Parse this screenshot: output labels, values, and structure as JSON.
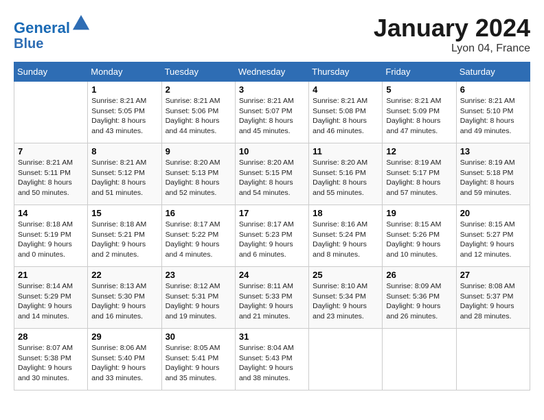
{
  "header": {
    "logo_line1": "General",
    "logo_line2": "Blue",
    "month_title": "January 2024",
    "location": "Lyon 04, France"
  },
  "weekdays": [
    "Sunday",
    "Monday",
    "Tuesday",
    "Wednesday",
    "Thursday",
    "Friday",
    "Saturday"
  ],
  "weeks": [
    [
      {
        "day": "",
        "sunrise": "",
        "sunset": "",
        "daylight": ""
      },
      {
        "day": "1",
        "sunrise": "Sunrise: 8:21 AM",
        "sunset": "Sunset: 5:05 PM",
        "daylight": "Daylight: 8 hours and 43 minutes."
      },
      {
        "day": "2",
        "sunrise": "Sunrise: 8:21 AM",
        "sunset": "Sunset: 5:06 PM",
        "daylight": "Daylight: 8 hours and 44 minutes."
      },
      {
        "day": "3",
        "sunrise": "Sunrise: 8:21 AM",
        "sunset": "Sunset: 5:07 PM",
        "daylight": "Daylight: 8 hours and 45 minutes."
      },
      {
        "day": "4",
        "sunrise": "Sunrise: 8:21 AM",
        "sunset": "Sunset: 5:08 PM",
        "daylight": "Daylight: 8 hours and 46 minutes."
      },
      {
        "day": "5",
        "sunrise": "Sunrise: 8:21 AM",
        "sunset": "Sunset: 5:09 PM",
        "daylight": "Daylight: 8 hours and 47 minutes."
      },
      {
        "day": "6",
        "sunrise": "Sunrise: 8:21 AM",
        "sunset": "Sunset: 5:10 PM",
        "daylight": "Daylight: 8 hours and 49 minutes."
      }
    ],
    [
      {
        "day": "7",
        "sunrise": "Sunrise: 8:21 AM",
        "sunset": "Sunset: 5:11 PM",
        "daylight": "Daylight: 8 hours and 50 minutes."
      },
      {
        "day": "8",
        "sunrise": "Sunrise: 8:21 AM",
        "sunset": "Sunset: 5:12 PM",
        "daylight": "Daylight: 8 hours and 51 minutes."
      },
      {
        "day": "9",
        "sunrise": "Sunrise: 8:20 AM",
        "sunset": "Sunset: 5:13 PM",
        "daylight": "Daylight: 8 hours and 52 minutes."
      },
      {
        "day": "10",
        "sunrise": "Sunrise: 8:20 AM",
        "sunset": "Sunset: 5:15 PM",
        "daylight": "Daylight: 8 hours and 54 minutes."
      },
      {
        "day": "11",
        "sunrise": "Sunrise: 8:20 AM",
        "sunset": "Sunset: 5:16 PM",
        "daylight": "Daylight: 8 hours and 55 minutes."
      },
      {
        "day": "12",
        "sunrise": "Sunrise: 8:19 AM",
        "sunset": "Sunset: 5:17 PM",
        "daylight": "Daylight: 8 hours and 57 minutes."
      },
      {
        "day": "13",
        "sunrise": "Sunrise: 8:19 AM",
        "sunset": "Sunset: 5:18 PM",
        "daylight": "Daylight: 8 hours and 59 minutes."
      }
    ],
    [
      {
        "day": "14",
        "sunrise": "Sunrise: 8:18 AM",
        "sunset": "Sunset: 5:19 PM",
        "daylight": "Daylight: 9 hours and 0 minutes."
      },
      {
        "day": "15",
        "sunrise": "Sunrise: 8:18 AM",
        "sunset": "Sunset: 5:21 PM",
        "daylight": "Daylight: 9 hours and 2 minutes."
      },
      {
        "day": "16",
        "sunrise": "Sunrise: 8:17 AM",
        "sunset": "Sunset: 5:22 PM",
        "daylight": "Daylight: 9 hours and 4 minutes."
      },
      {
        "day": "17",
        "sunrise": "Sunrise: 8:17 AM",
        "sunset": "Sunset: 5:23 PM",
        "daylight": "Daylight: 9 hours and 6 minutes."
      },
      {
        "day": "18",
        "sunrise": "Sunrise: 8:16 AM",
        "sunset": "Sunset: 5:24 PM",
        "daylight": "Daylight: 9 hours and 8 minutes."
      },
      {
        "day": "19",
        "sunrise": "Sunrise: 8:15 AM",
        "sunset": "Sunset: 5:26 PM",
        "daylight": "Daylight: 9 hours and 10 minutes."
      },
      {
        "day": "20",
        "sunrise": "Sunrise: 8:15 AM",
        "sunset": "Sunset: 5:27 PM",
        "daylight": "Daylight: 9 hours and 12 minutes."
      }
    ],
    [
      {
        "day": "21",
        "sunrise": "Sunrise: 8:14 AM",
        "sunset": "Sunset: 5:29 PM",
        "daylight": "Daylight: 9 hours and 14 minutes."
      },
      {
        "day": "22",
        "sunrise": "Sunrise: 8:13 AM",
        "sunset": "Sunset: 5:30 PM",
        "daylight": "Daylight: 9 hours and 16 minutes."
      },
      {
        "day": "23",
        "sunrise": "Sunrise: 8:12 AM",
        "sunset": "Sunset: 5:31 PM",
        "daylight": "Daylight: 9 hours and 19 minutes."
      },
      {
        "day": "24",
        "sunrise": "Sunrise: 8:11 AM",
        "sunset": "Sunset: 5:33 PM",
        "daylight": "Daylight: 9 hours and 21 minutes."
      },
      {
        "day": "25",
        "sunrise": "Sunrise: 8:10 AM",
        "sunset": "Sunset: 5:34 PM",
        "daylight": "Daylight: 9 hours and 23 minutes."
      },
      {
        "day": "26",
        "sunrise": "Sunrise: 8:09 AM",
        "sunset": "Sunset: 5:36 PM",
        "daylight": "Daylight: 9 hours and 26 minutes."
      },
      {
        "day": "27",
        "sunrise": "Sunrise: 8:08 AM",
        "sunset": "Sunset: 5:37 PM",
        "daylight": "Daylight: 9 hours and 28 minutes."
      }
    ],
    [
      {
        "day": "28",
        "sunrise": "Sunrise: 8:07 AM",
        "sunset": "Sunset: 5:38 PM",
        "daylight": "Daylight: 9 hours and 30 minutes."
      },
      {
        "day": "29",
        "sunrise": "Sunrise: 8:06 AM",
        "sunset": "Sunset: 5:40 PM",
        "daylight": "Daylight: 9 hours and 33 minutes."
      },
      {
        "day": "30",
        "sunrise": "Sunrise: 8:05 AM",
        "sunset": "Sunset: 5:41 PM",
        "daylight": "Daylight: 9 hours and 35 minutes."
      },
      {
        "day": "31",
        "sunrise": "Sunrise: 8:04 AM",
        "sunset": "Sunset: 5:43 PM",
        "daylight": "Daylight: 9 hours and 38 minutes."
      },
      {
        "day": "",
        "sunrise": "",
        "sunset": "",
        "daylight": ""
      },
      {
        "day": "",
        "sunrise": "",
        "sunset": "",
        "daylight": ""
      },
      {
        "day": "",
        "sunrise": "",
        "sunset": "",
        "daylight": ""
      }
    ]
  ]
}
